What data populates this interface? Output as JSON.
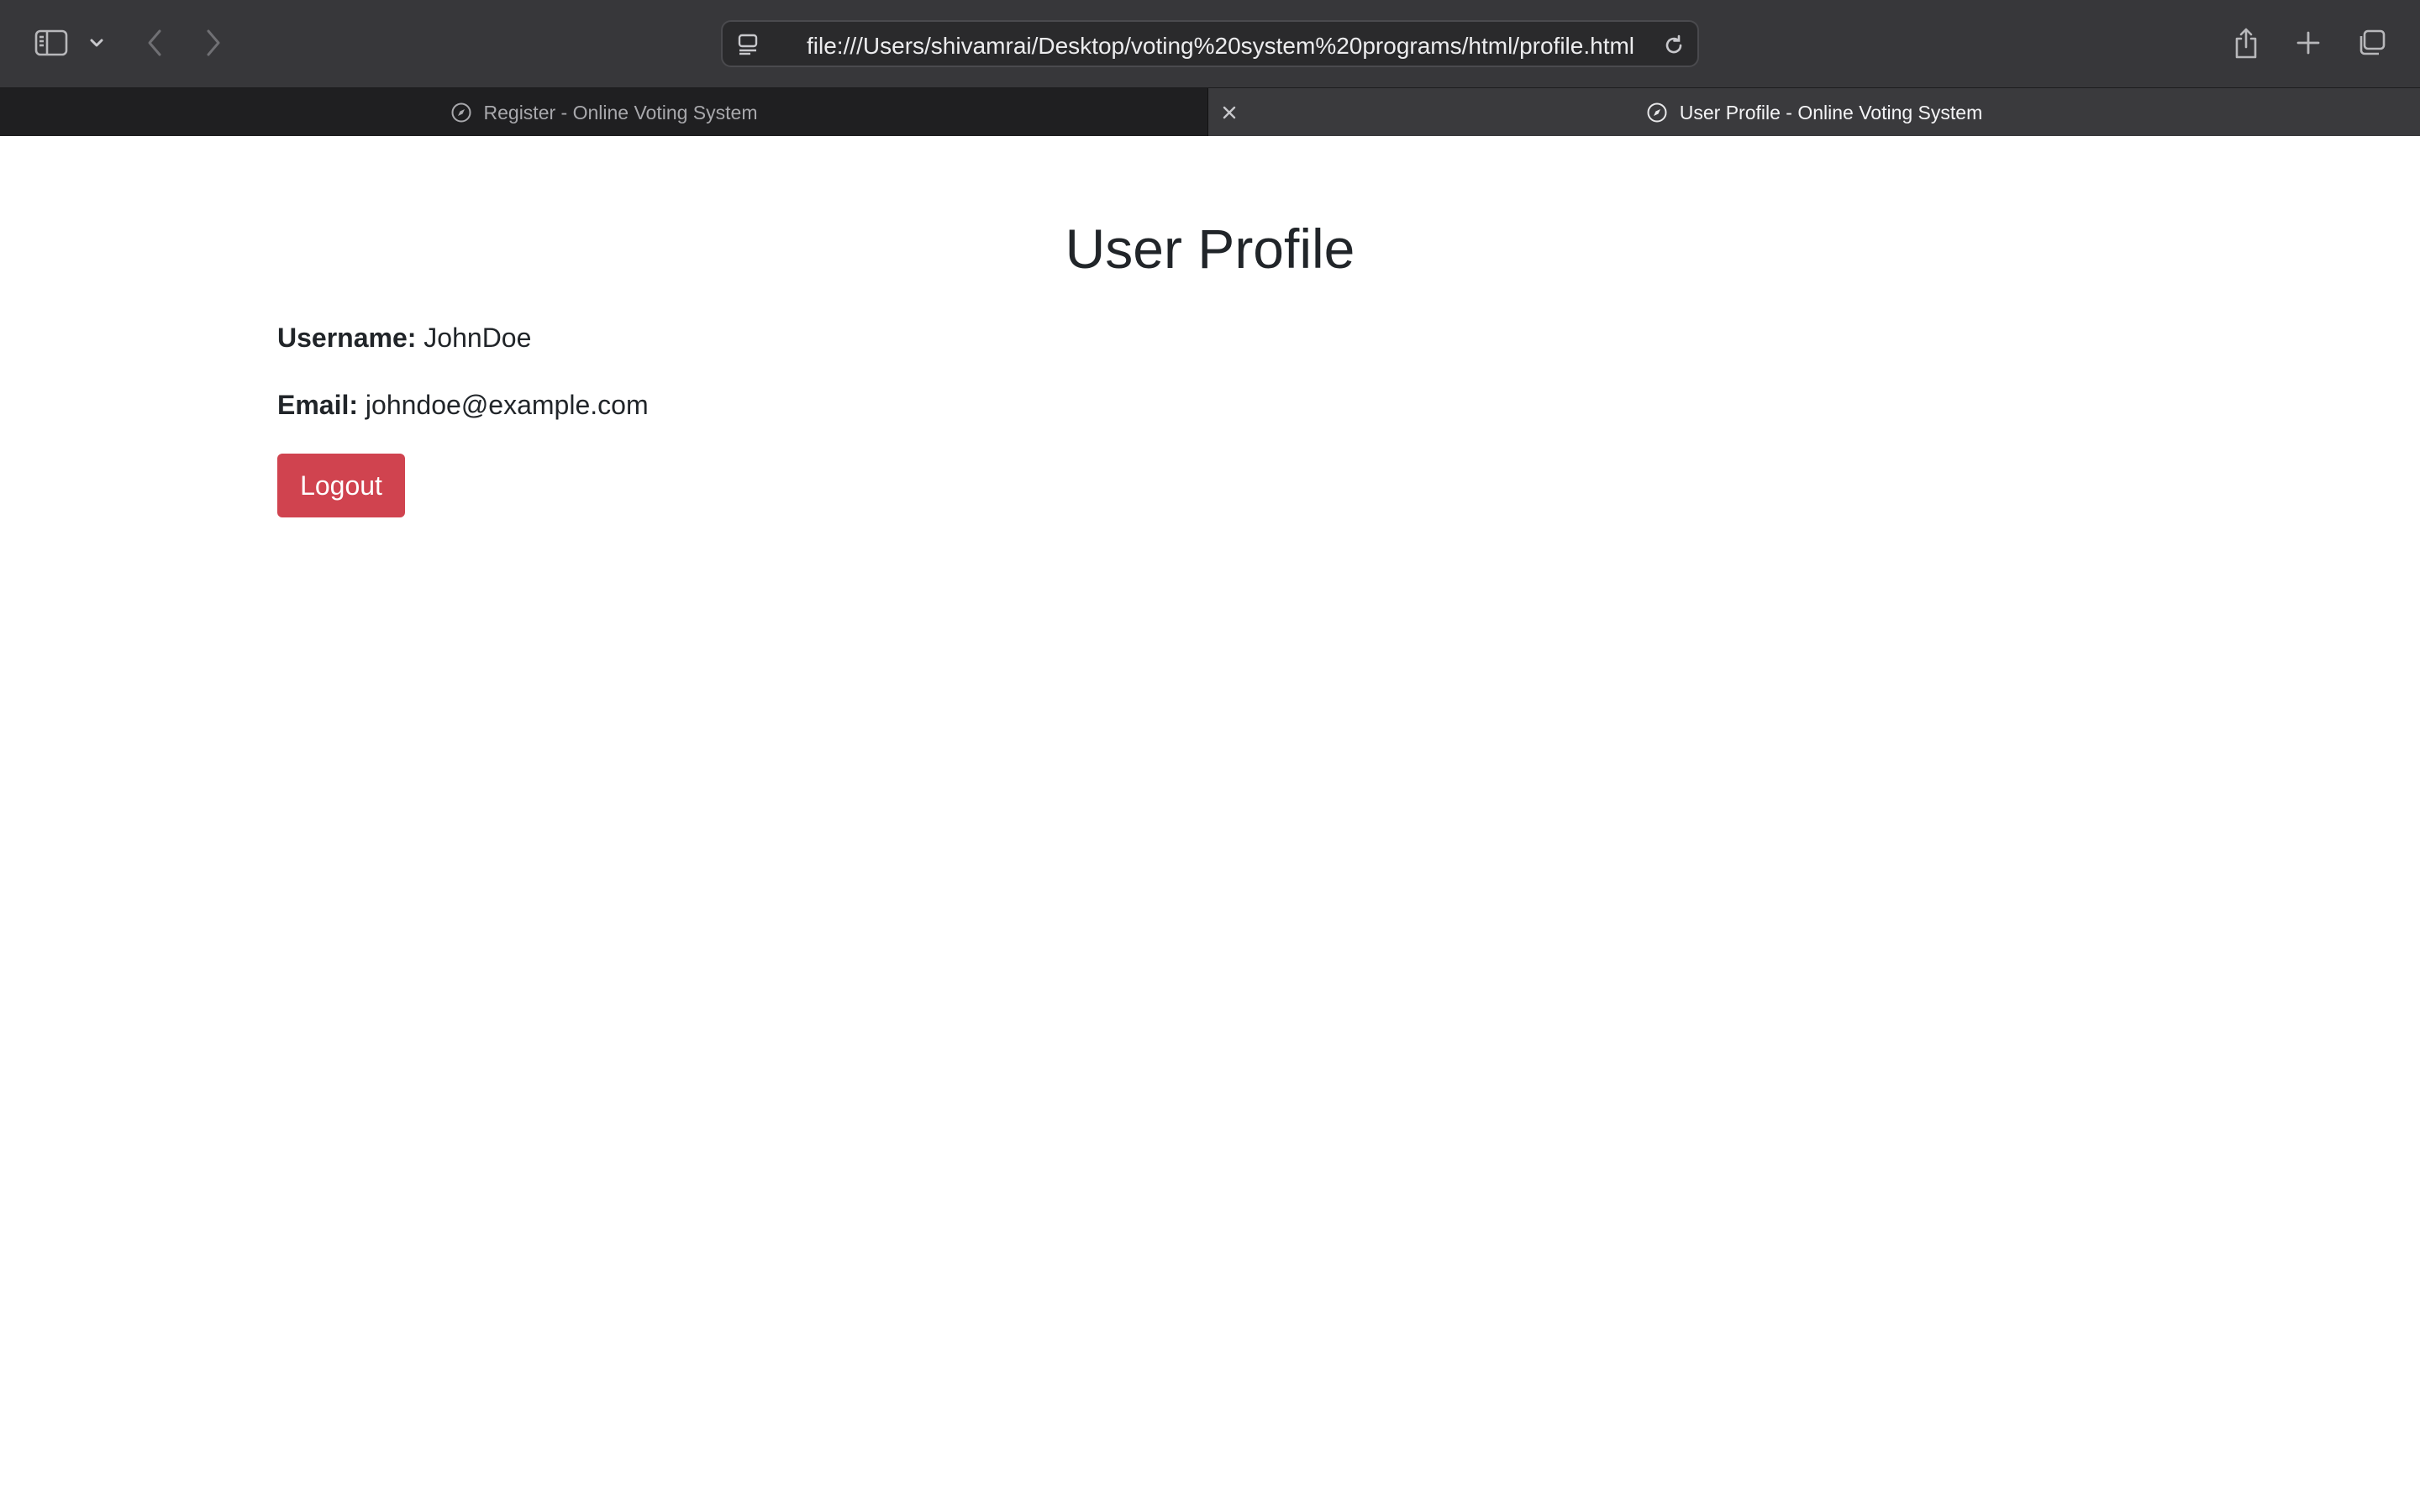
{
  "browser": {
    "address": {
      "url": "file:///Users/shivamrai/Desktop/voting%20system%20programs/html/profile.html"
    },
    "tabs": [
      {
        "label": "Register - Online Voting System",
        "active": false,
        "icon": "compass-icon"
      },
      {
        "label": "User Profile - Online Voting System",
        "active": true,
        "icon": "compass-icon"
      }
    ],
    "icons": {
      "sidebar": "sidebar-icon",
      "sidebar_dropdown": "chevron-down-icon",
      "back": "chevron-left-icon",
      "forward": "chevron-right-icon",
      "page_info": "page-menu-icon",
      "reload": "reload-icon",
      "share": "share-icon",
      "new_tab": "plus-icon",
      "tab_overview": "tab-overview-icon",
      "close_tab": "close-icon"
    }
  },
  "profile": {
    "title": "User Profile",
    "username_label": "Username:",
    "username_value": "JohnDoe",
    "email_label": "Email:",
    "email_value": "johndoe@example.com",
    "logout_label": "Logout"
  },
  "colors": {
    "toolbar_bg": "#37373a",
    "logout_button": "#d0434f",
    "text": "#212529"
  }
}
